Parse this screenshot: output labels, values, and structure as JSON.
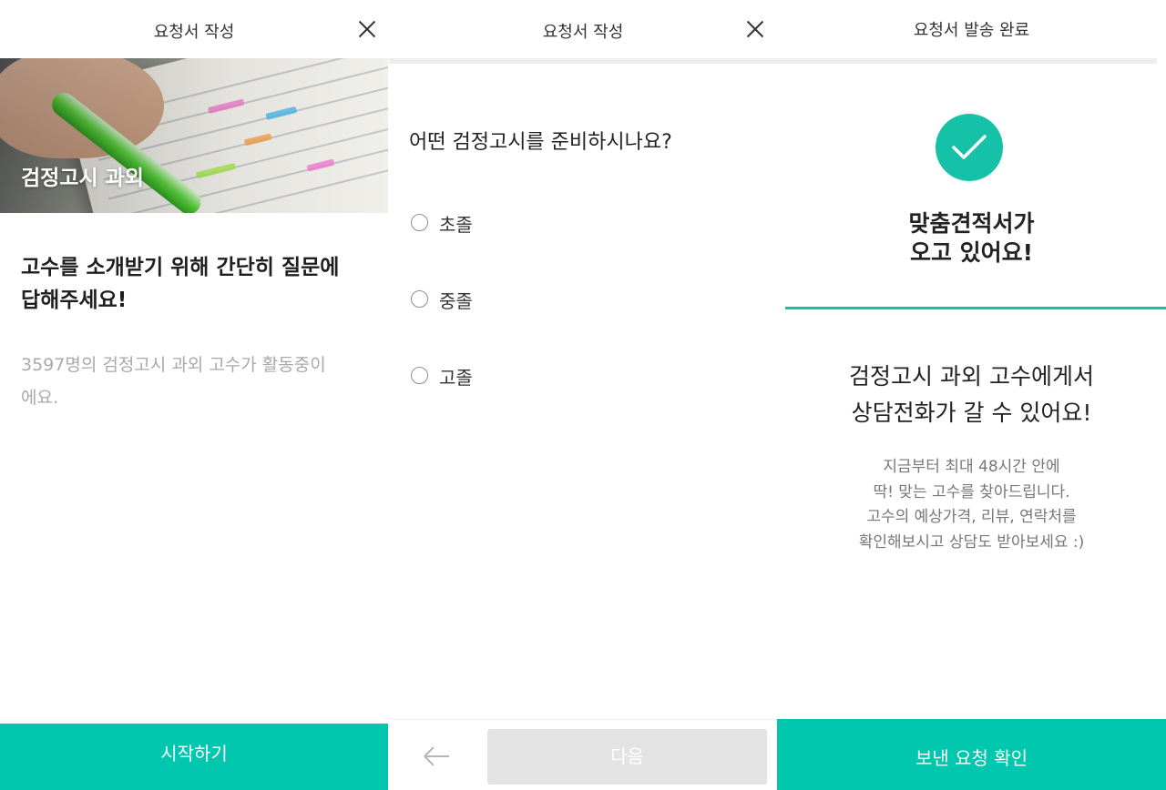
{
  "screen1": {
    "header_title": "요청서 작성",
    "hero_label": "검정고시 과외",
    "heading_line1": "고수를 소개받기 위해 간단히 질문에",
    "heading_line2": "답해주세요!",
    "subtext_line1": "3597명의 검정고시 과외 고수가 활동중이",
    "subtext_line2": "에요.",
    "cta_label": "시작하기"
  },
  "screen2": {
    "header_title": "요청서 작성",
    "question": "어떤 검정고시를 준비하시나요?",
    "options": [
      {
        "label": "초졸"
      },
      {
        "label": "중졸"
      },
      {
        "label": "고졸"
      }
    ],
    "next_label": "다음"
  },
  "screen3": {
    "header_title": "요청서 발송 완료",
    "done_line1": "맞춤견적서가",
    "done_line2": "오고 있어요!",
    "info_line1": "검정고시 과외 고수에게서",
    "info_line2": "상담전화가 갈 수 있어요!",
    "desc_lines": [
      "지금부터 최대 48시간 안에",
      "딱! 맞는 고수를 찾아드립니다.",
      "고수의 예상가격, 리뷰, 연락처를",
      "확인해보시고 상담도 받아보세요 :)"
    ],
    "cta_label": "보낸 요청 확인"
  },
  "theme": {
    "accent": "#00c7ae",
    "check_color": "#16c2a7",
    "disabled_button": "#e3e3e3"
  },
  "icons": [
    "close-icon",
    "back-arrow-icon",
    "check-icon",
    "radio-icon"
  ]
}
